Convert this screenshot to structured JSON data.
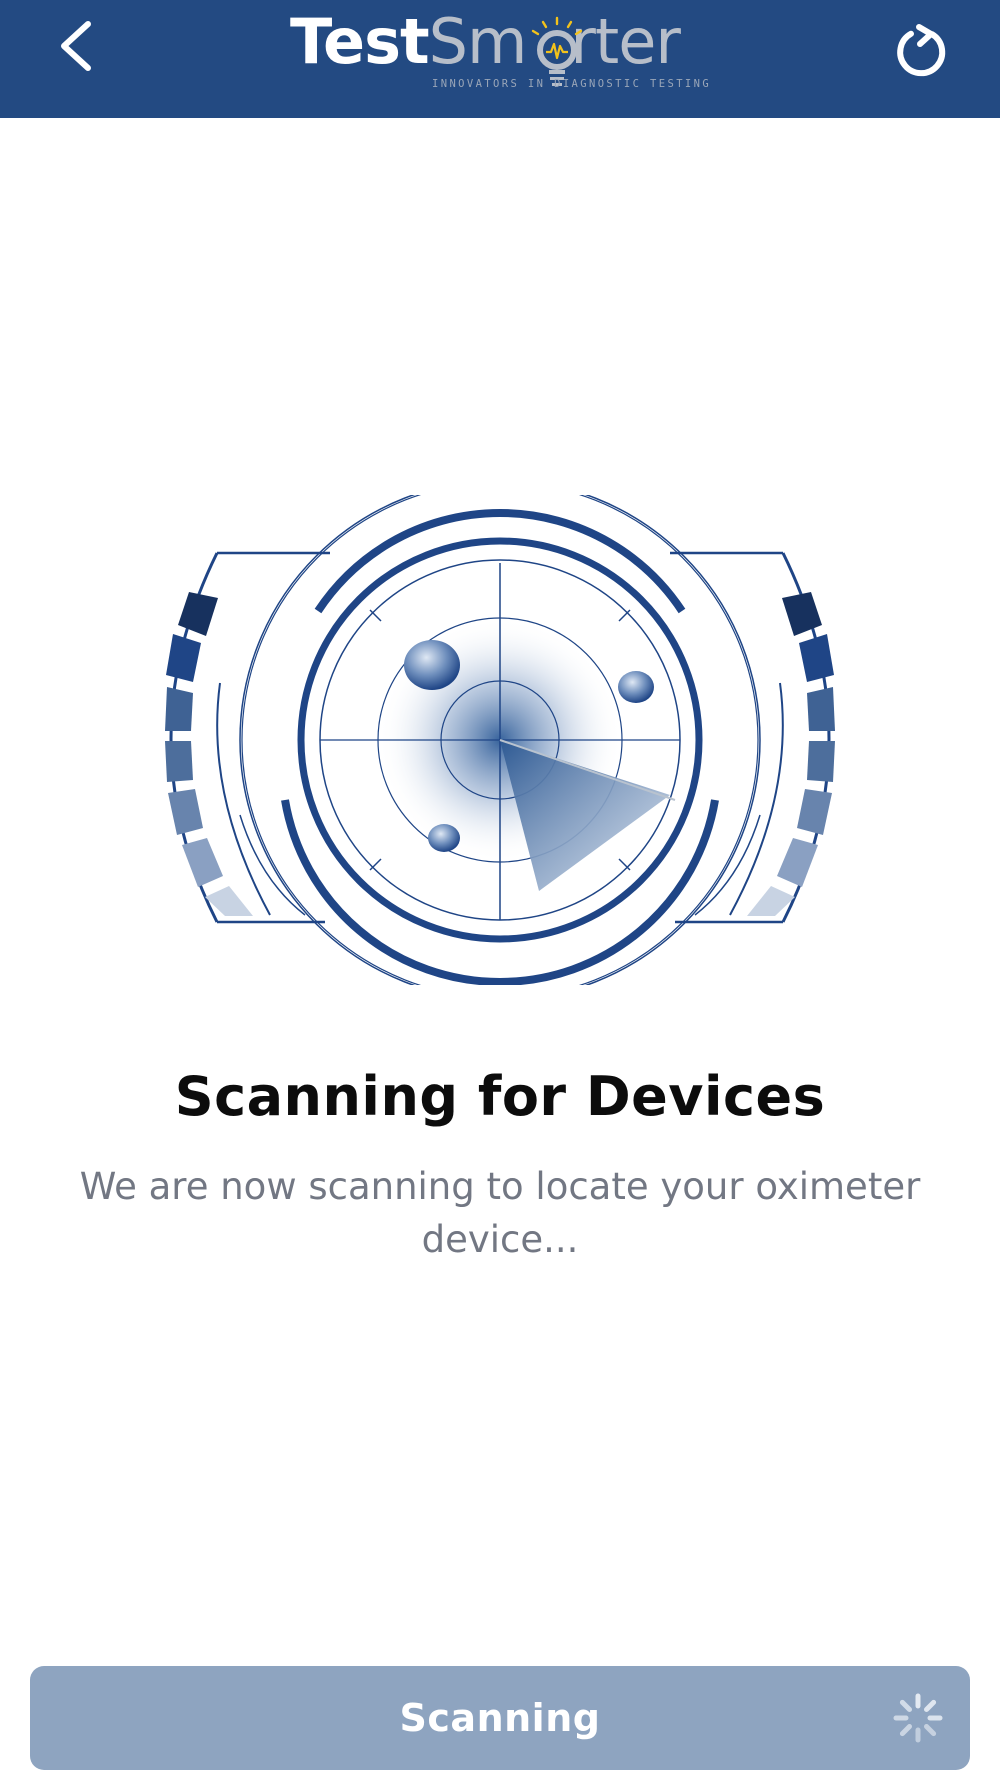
{
  "header": {
    "back_icon": "chevron-left-icon",
    "refresh_icon": "refresh-icon",
    "logo": {
      "part1": "Test",
      "part2a": "Sm",
      "part2b": "rter",
      "tagline": "INNOVATORS IN  DIAGNOSTIC TESTING"
    }
  },
  "main": {
    "illustration": "radar-scan-illustration",
    "title": "Scanning for Devices",
    "subtitle": "We are now scanning to locate your oximeter device..."
  },
  "footer": {
    "button_label": "Scanning",
    "spinner_icon": "spinner-icon"
  },
  "colors": {
    "header_bg": "#234a82",
    "accent": "#1f4586",
    "button_bg": "#8ea4c0",
    "title": "#0c0c0c",
    "subtitle": "#727783"
  }
}
